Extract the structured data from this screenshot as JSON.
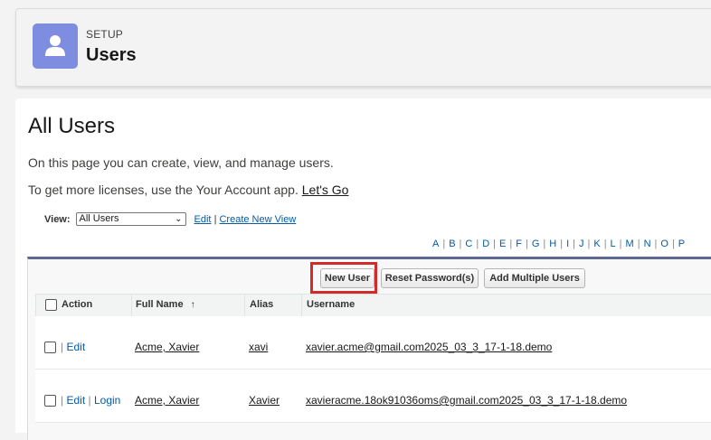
{
  "header": {
    "setup_label": "SETUP",
    "title": "Users",
    "icon": "user-icon",
    "icon_bg": "#7f8de1"
  },
  "main": {
    "title": "All Users",
    "description": "On this page you can create, view, and manage users.",
    "licenses_text": "To get more licenses, use the Your Account app. ",
    "licenses_link": "Let's Go"
  },
  "view": {
    "label": "View:",
    "selected": "All Users",
    "edit_link": "Edit",
    "separator": "|",
    "create_link": "Create New View"
  },
  "alphabet": [
    "A",
    "B",
    "C",
    "D",
    "E",
    "F",
    "G",
    "H",
    "I",
    "J",
    "K",
    "L",
    "M",
    "N",
    "O",
    "P"
  ],
  "toolbar": {
    "new_user": "New User",
    "reset_password": "Reset Password(s)",
    "add_multiple": "Add Multiple Users",
    "highlight_color": "#d22b2b"
  },
  "table": {
    "columns": [
      "Action",
      "Full Name",
      "Alias",
      "Username"
    ],
    "sort_indicator": "↑",
    "rows": [
      {
        "actions": "Edit",
        "full_name": "Acme, Xavier",
        "alias": "xavi",
        "username": "xavier.acme@gmail.com2025_03_3_17-1-18.demo"
      },
      {
        "actions": "Edit",
        "action_login": "Login",
        "full_name": "Acme, Xavier",
        "alias": "Xavier",
        "username": "xavieracme.18ok91036oms@gmail.com2025_03_3_17-1-18.demo"
      }
    ]
  }
}
